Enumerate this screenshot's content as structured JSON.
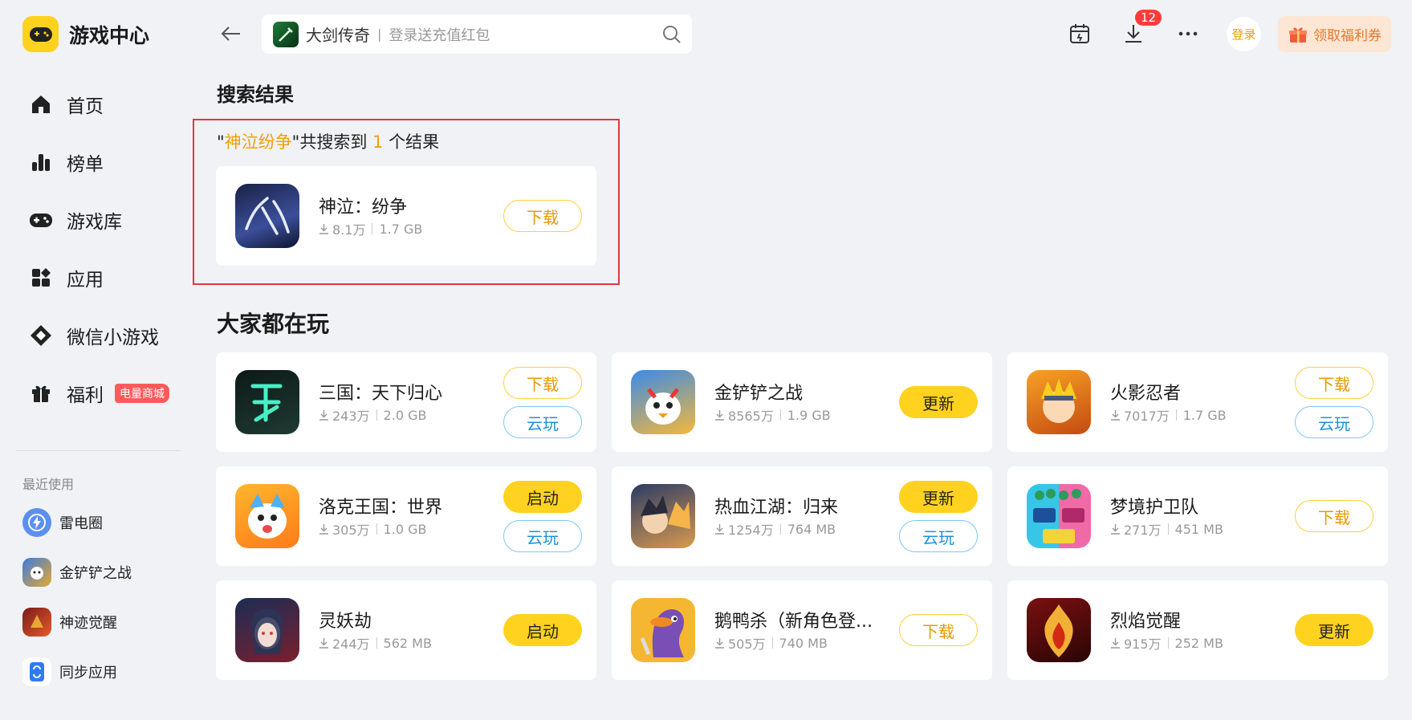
{
  "app": {
    "title": "游戏中心"
  },
  "nav": [
    {
      "label": "首页",
      "icon": "home-icon"
    },
    {
      "label": "榜单",
      "icon": "ranking-icon"
    },
    {
      "label": "游戏库",
      "icon": "gamepad-icon"
    },
    {
      "label": "应用",
      "icon": "apps-icon"
    },
    {
      "label": "微信小游戏",
      "icon": "wechat-minigame-icon"
    },
    {
      "label": "福利",
      "icon": "gift-icon",
      "badge": "电量商城"
    }
  ],
  "recent": {
    "title": "最近使用",
    "items": [
      {
        "label": "雷电圈"
      },
      {
        "label": "金铲铲之战"
      },
      {
        "label": "神迹觉醒"
      },
      {
        "label": "同步应用"
      }
    ]
  },
  "search": {
    "game_name": "大剑传奇",
    "separator": "|",
    "placeholder": "登录送充值红包"
  },
  "header": {
    "download_count": "12",
    "login_label": "登录",
    "coupon_label": "领取福利券"
  },
  "results": {
    "section_title": "搜索结果",
    "quote_open": "\"",
    "query": "神泣纷争",
    "quote_close": "\"",
    "summary_mid": "共搜索到 ",
    "count": "1",
    "summary_end": " 个结果",
    "item": {
      "name": "神泣：纷争",
      "downloads": "8.1万",
      "size": "1.7 GB",
      "button": "下载"
    }
  },
  "popular": {
    "title": "大家都在玩",
    "games": [
      {
        "name": "三国：天下归心",
        "downloads": "243万",
        "size": "2.0 GB",
        "buttons": [
          "下载",
          "云玩"
        ]
      },
      {
        "name": "金铲铲之战",
        "downloads": "8565万",
        "size": "1.9 GB",
        "buttons": [
          "更新"
        ]
      },
      {
        "name": "火影忍者",
        "downloads": "7017万",
        "size": "1.7 GB",
        "buttons": [
          "下载",
          "云玩"
        ]
      },
      {
        "name": "洛克王国：世界",
        "downloads": "305万",
        "size": "1.0 GB",
        "buttons": [
          "启动",
          "云玩"
        ]
      },
      {
        "name": "热血江湖：归来",
        "downloads": "1254万",
        "size": "764 MB",
        "buttons": [
          "更新",
          "云玩"
        ]
      },
      {
        "name": "梦境护卫队",
        "downloads": "271万",
        "size": "451 MB",
        "buttons": [
          "下载"
        ]
      },
      {
        "name": "灵妖劫",
        "downloads": "244万",
        "size": "562 MB",
        "buttons": [
          "启动"
        ]
      },
      {
        "name": "鹅鸭杀（新角色登...",
        "downloads": "505万",
        "size": "740 MB",
        "buttons": [
          "下载"
        ]
      },
      {
        "name": "烈焰觉醒",
        "downloads": "915万",
        "size": "252 MB",
        "buttons": [
          "更新"
        ]
      }
    ]
  },
  "colors": {
    "accent_yellow": "#ffd21f",
    "highlight_red": "#e0393e",
    "cloud_blue": "#1e90d8",
    "badge_red": "#ff5a5a"
  }
}
